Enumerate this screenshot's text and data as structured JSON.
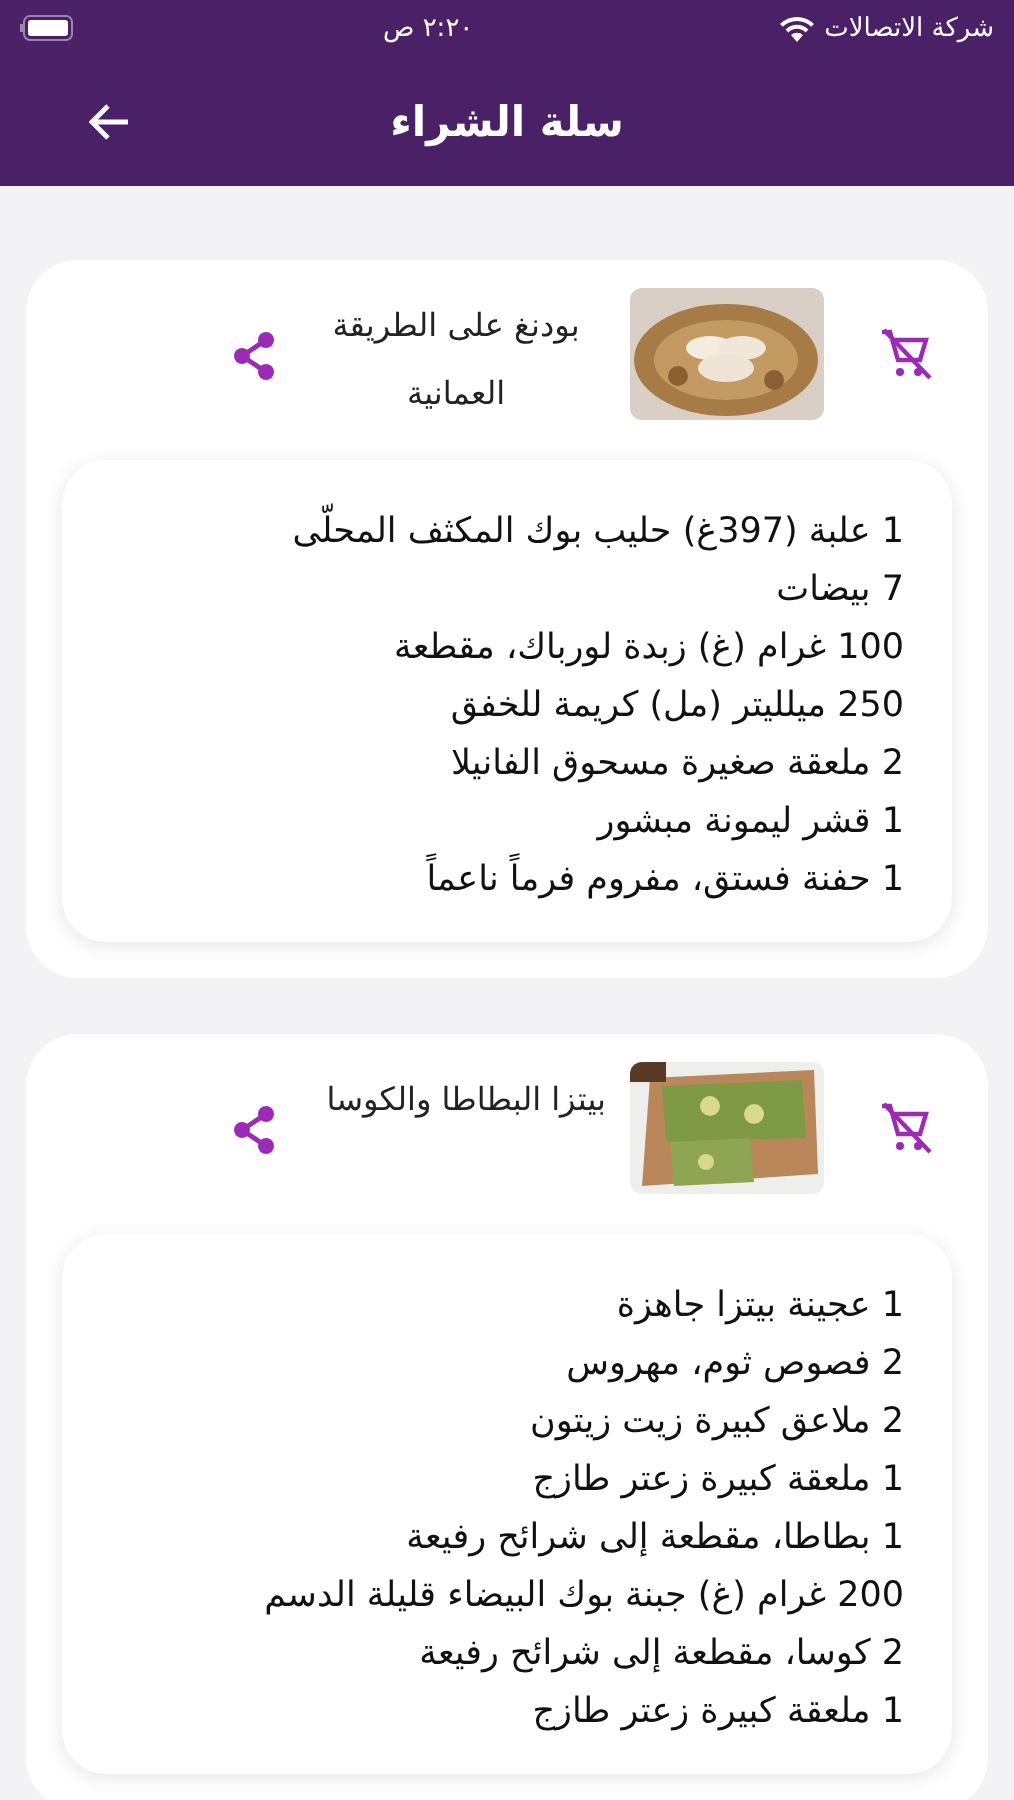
{
  "status_bar": {
    "carrier": "شركة الاتصالات",
    "time": "٢:٢٠ ص"
  },
  "header": {
    "title": "سلة الشراء"
  },
  "recipes": [
    {
      "title": "بودنغ على الطريقة العمانية",
      "picture": {
        "kind": "picture"
      },
      "ingredients": [
        "1 علبة (397غ) حليب بوك المكثف المحلّى",
        "7 بيضات",
        "100 غرام (غ) زبدة لورباك، مقطعة",
        "250 ميلليتر (مل) كريمة للخفق",
        "2 ملعقة صغيرة مسحوق الفانيلا",
        "1 قشر ليمونة مبشور",
        "1 حفنة فستق، مفروم فرماً ناعماً"
      ]
    },
    {
      "title": "بيتزا البطاطا والكوسا",
      "picture": {
        "kind": "picture"
      },
      "ingredients": [
        "1 عجينة بيتزا جاهزة",
        "2 فصوص ثوم، مهروس",
        "2 ملاعق كبيرة زيت زيتون",
        "1 ملعقة كبيرة زعتر طازج",
        "1 بطاطا، مقطعة إلى شرائح رفيعة",
        "200 غرام (غ) جبنة بوك البيضاء قليلة الدسم",
        "2 كوسا، مقطعة إلى شرائح رفيعة",
        "1 ملعقة كبيرة زعتر طازج"
      ]
    }
  ]
}
